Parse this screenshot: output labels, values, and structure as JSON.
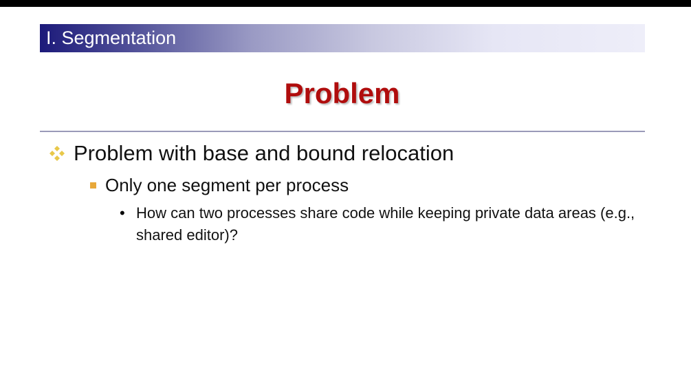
{
  "header": {
    "section": "I. Segmentation"
  },
  "title": "Problem",
  "bullets": {
    "level1": "Problem with base and bound relocation",
    "level2": "Only one segment per process",
    "level3": "How can two processes share code while keeping private data areas (e.g., shared editor)?",
    "level3_marker": "•"
  },
  "colors": {
    "title": "#b00d0d",
    "header_start": "#1c1a7a",
    "bullet1": "#e8c84a",
    "bullet2": "#e8a83a"
  }
}
